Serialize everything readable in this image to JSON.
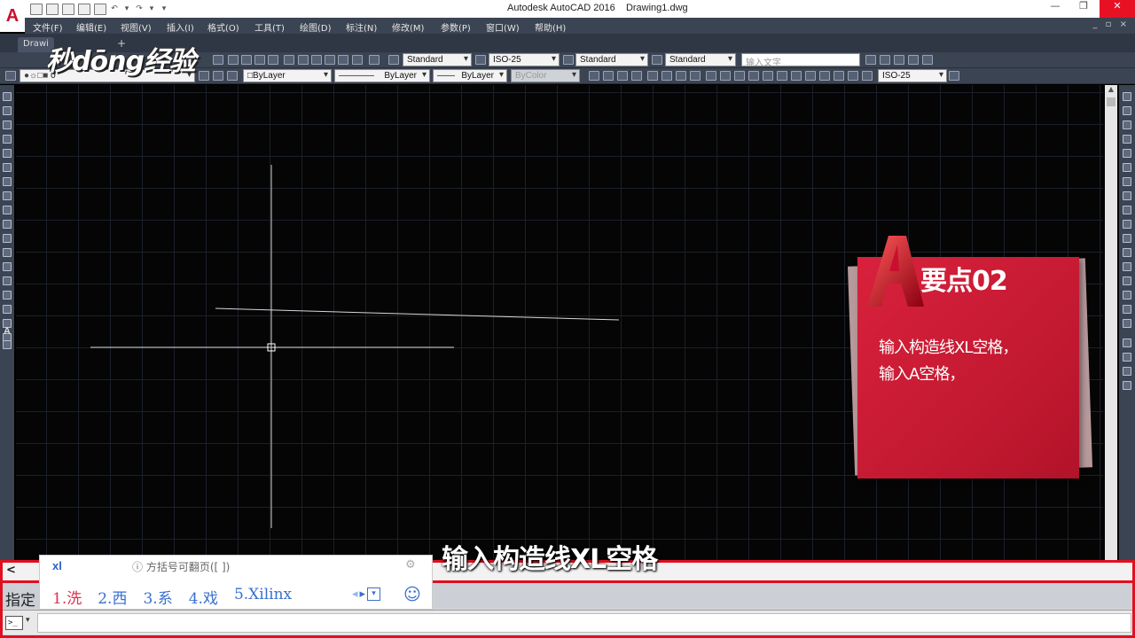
{
  "window": {
    "app_title": "Autodesk AutoCAD 2016",
    "document_title": "Drawing1.dwg",
    "min_glyph": "—",
    "max_glyph": "❐",
    "close_glyph": "✕"
  },
  "menubar": {
    "items": [
      "文件(F)",
      "编辑(E)",
      "视图(V)",
      "插入(I)",
      "格式(O)",
      "工具(T)",
      "绘图(D)",
      "标注(N)",
      "修改(M)",
      "参数(P)",
      "窗口(W)",
      "帮助(H)"
    ],
    "doc_controls": "_ ▫ ×"
  },
  "tabs": {
    "file_tab": "Drawi",
    "add_glyph": "+",
    "watermark": "秒dōng经验"
  },
  "toolbar_styles": {
    "text_style": "Standard",
    "dim_style": "ISO-25",
    "table_style": "Standard",
    "mleader_style": "Standard",
    "search_placeholder": "输入文字"
  },
  "toolbar_layers": {
    "layer": "0",
    "color": "ByLayer",
    "linetype": "ByLayer",
    "lineweight": "ByLayer",
    "plotstyle": "ByColor",
    "dim_style2": "ISO-25"
  },
  "card": {
    "title": "要点02",
    "line1": "输入构造线XL空格，",
    "line2": "输入A空格，"
  },
  "subtitle": "输入构造线XL空格",
  "command": {
    "history_glyph": "<",
    "prompt": "指定",
    "icon_label": ">_",
    "icon_drop": "▾"
  },
  "ime": {
    "composition": "xl",
    "hint": "ⓘ 方括号可翻页([ ])",
    "gear_glyph": "⚙",
    "candidates": [
      "1.洗",
      "2.西",
      "3.系",
      "4.戏",
      "5.Xilinx"
    ],
    "nav_prev": "◂",
    "nav_next": "▸",
    "nav_drop": "▾",
    "emoji_glyph": "☺"
  },
  "colors": {
    "accent_red": "#e01020",
    "card_red": "#d9213c",
    "toolbar_bg": "#3b4453"
  }
}
